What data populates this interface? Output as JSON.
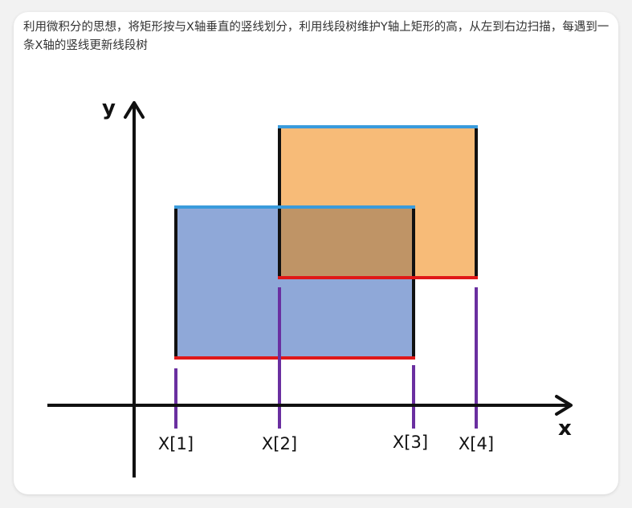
{
  "description": "利用微积分的思想，将矩形按与X轴垂直的竖线划分，利用线段树维护Y轴上矩形的高，从左到右边扫描，每遇到一条X轴的竖线更新线段树",
  "diagram": {
    "x_axis_label": "x",
    "y_axis_label": "y",
    "scanline_labels": [
      "X[1]",
      "X[2]",
      "X[3]",
      "X[4]"
    ],
    "colors": {
      "rect_blue": "#8fa8d8",
      "rect_orange": "#f7bb78",
      "overlap": "#bf9466",
      "top_edge": "#3a9bdc",
      "bottom_edge": "#e01818",
      "scanline": "#6a2fa0",
      "axis": "#111111"
    }
  }
}
